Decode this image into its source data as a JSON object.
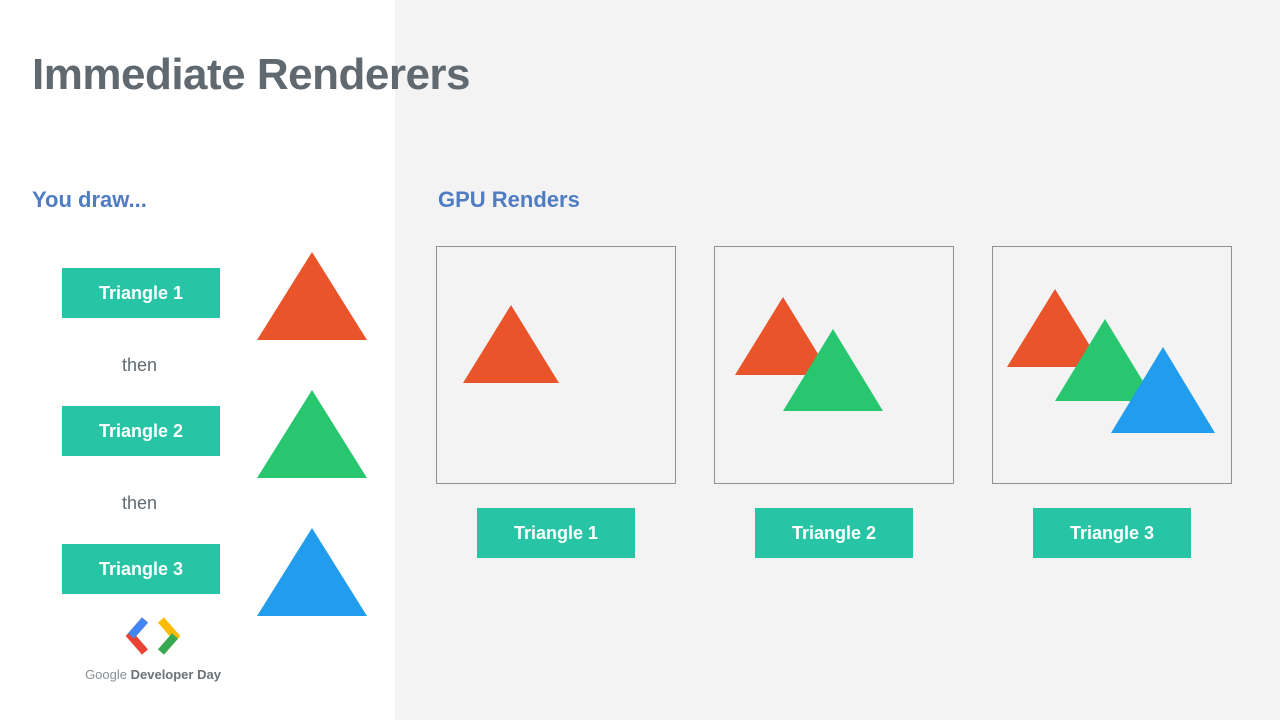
{
  "title": "Immediate Renderers",
  "left_label": "You draw...",
  "right_label": "GPU Renders",
  "then": "then",
  "draw_steps": [
    {
      "label": "Triangle 1",
      "color": "orange"
    },
    {
      "label": "Triangle 2",
      "color": "green"
    },
    {
      "label": "Triangle 3",
      "color": "blue"
    }
  ],
  "render_steps": [
    {
      "label": "Triangle 1",
      "triangles": [
        "orange"
      ]
    },
    {
      "label": "Triangle 2",
      "triangles": [
        "orange",
        "green"
      ]
    },
    {
      "label": "Triangle 3",
      "triangles": [
        "orange",
        "green",
        "blue"
      ]
    }
  ],
  "colors": {
    "orange": "#ea542a",
    "green": "#28c76f",
    "blue": "#229cec",
    "teal": "#27c4a5",
    "heading_blue": "#4f7cc2"
  },
  "logo": {
    "line1": "Google",
    "line2": "Developer Day"
  }
}
